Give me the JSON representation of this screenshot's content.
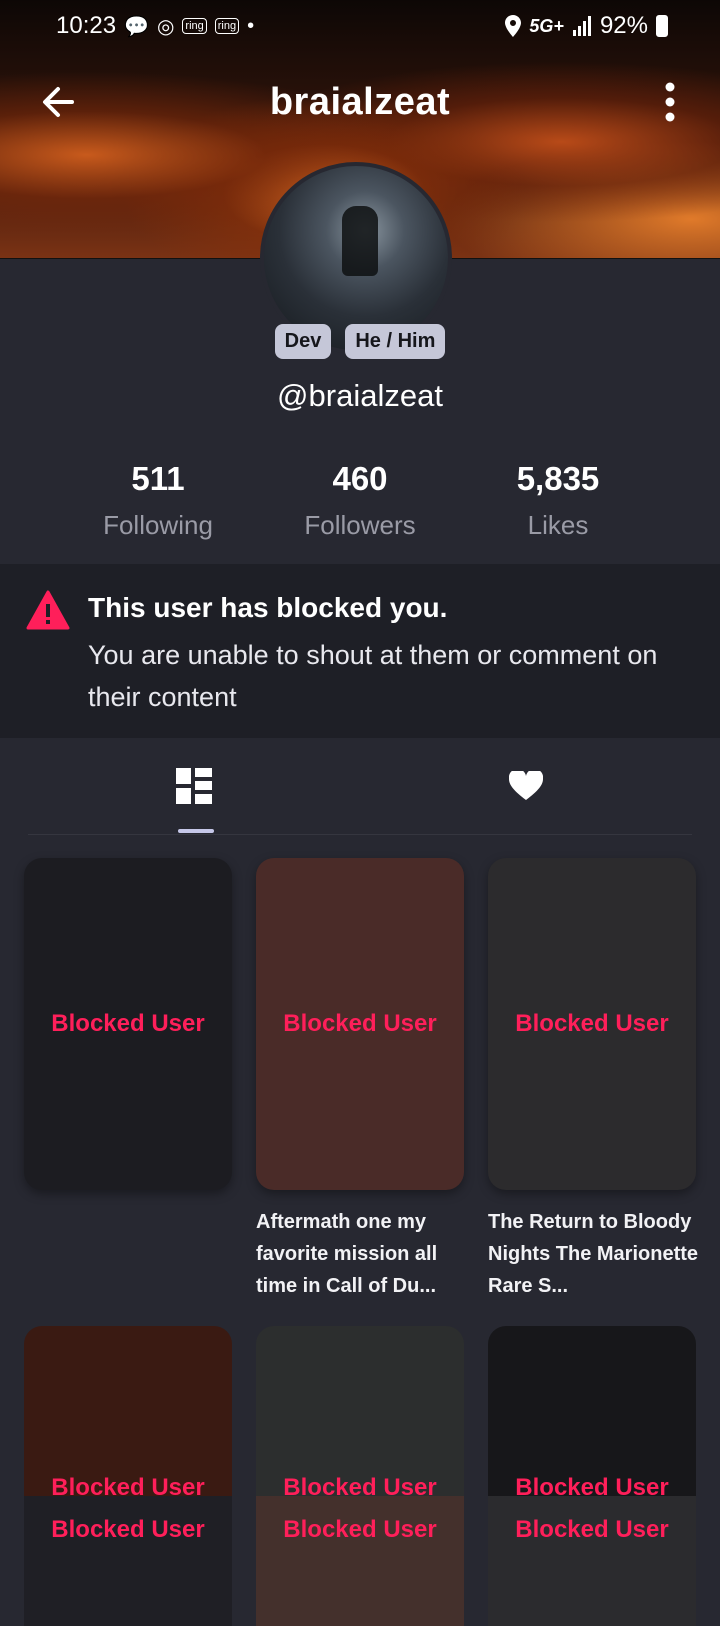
{
  "status_bar": {
    "time": "10:23",
    "icons": [
      "chat-icon",
      "signal-app-icon",
      "ring-icon",
      "ring-icon",
      "dot-icon"
    ],
    "ring_label": "ring",
    "network": "5G+",
    "battery": "92%"
  },
  "header": {
    "title": "braialzeat"
  },
  "profile": {
    "badges": [
      "Dev",
      "He / Him"
    ],
    "handle": "@braialzeat"
  },
  "stats": [
    {
      "value": "511",
      "label": "Following"
    },
    {
      "value": "460",
      "label": "Followers"
    },
    {
      "value": "5,835",
      "label": "Likes"
    }
  ],
  "blocked_notice": {
    "title": "This user has blocked you.",
    "message": "You are unable to shout at them or comment on their content"
  },
  "tabs": [
    {
      "icon": "grid-layout-icon",
      "selected": true
    },
    {
      "icon": "heart-icon",
      "selected": false
    }
  ],
  "grid": {
    "row1": [
      {
        "label": "Blocked User",
        "color": "#1c1c21",
        "caption": ""
      },
      {
        "label": "Blocked User",
        "color": "#4a2b28",
        "caption": "Aftermath one my favorite mission all time in Call of Du..."
      },
      {
        "label": "Blocked User",
        "color": "#2c2b2d",
        "caption": "The Return to Bloody Nights The Marionette Rare S..."
      }
    ],
    "row2": [
      {
        "label": "Blocked User",
        "color": "#3a1a12",
        "overlay_color": "#1f1f25"
      },
      {
        "label": "Blocked User",
        "color": "#2c2e2e",
        "overlay_color": "#44302c"
      },
      {
        "label": "Blocked User",
        "color": "#17171a",
        "overlay_color": "#2b2b2e"
      }
    ]
  },
  "colors": {
    "accent": "#ff1f5a",
    "background": "#272831",
    "panel": "#1e1f26"
  }
}
